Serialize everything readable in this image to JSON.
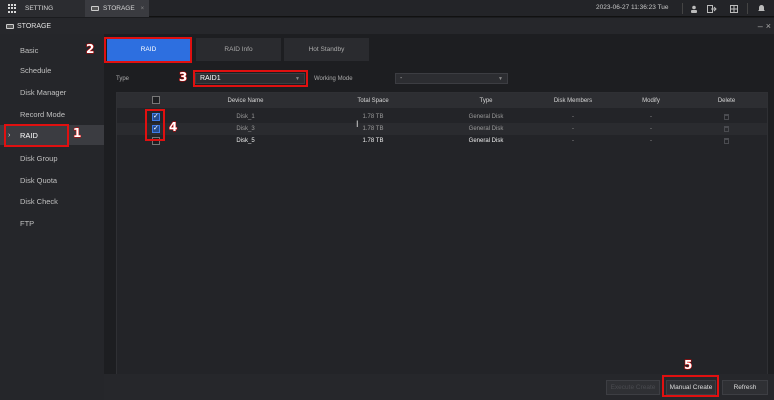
{
  "topbar": {
    "setting_tab": "SETTING",
    "storage_tab": "STORAGE",
    "close": "×",
    "datetime": "2023-06-27 11:36:23 Tue"
  },
  "titlebar": {
    "title": "STORAGE",
    "minimize": "–",
    "close": "×"
  },
  "sidebar": {
    "items": [
      {
        "label": "Basic"
      },
      {
        "label": "Schedule"
      },
      {
        "label": "Disk Manager"
      },
      {
        "label": "Record Mode"
      },
      {
        "label": "RAID"
      },
      {
        "label": "Disk Group"
      },
      {
        "label": "Disk Quota"
      },
      {
        "label": "Disk Check"
      },
      {
        "label": "FTP"
      }
    ],
    "active": "RAID",
    "active_marker": "›"
  },
  "tabs": [
    {
      "label": "RAID"
    },
    {
      "label": "RAID Info"
    },
    {
      "label": "Hot Standby"
    }
  ],
  "form": {
    "type_label": "Type",
    "type_value": "RAID1",
    "working_mode_label": "Working Mode",
    "working_mode_value": "-"
  },
  "table": {
    "headers": [
      "",
      "Device Name",
      "Total Space",
      "Type",
      "Disk Members",
      "Modify",
      "Delete"
    ],
    "rows": [
      {
        "checked": true,
        "device": "Disk_1",
        "space": "1.78 TB",
        "type": "General Disk",
        "members": "-",
        "modify": "-"
      },
      {
        "checked": true,
        "device": "Disk_3",
        "space": "1.78 TB",
        "type": "General Disk",
        "members": "-",
        "modify": "-"
      },
      {
        "checked": false,
        "device": "Disk_5",
        "space": "1.78 TB",
        "type": "General Disk",
        "members": "-",
        "modify": "-"
      }
    ]
  },
  "footer": {
    "hidden_button": "Execute Create",
    "manual_create": "Manual Create",
    "refresh": "Refresh"
  },
  "annotations": [
    "1",
    "2",
    "3",
    "4",
    "5"
  ],
  "colors": {
    "accent": "#2d6fe0",
    "highlight_box": "#e01010",
    "background": "#1d1e21"
  }
}
